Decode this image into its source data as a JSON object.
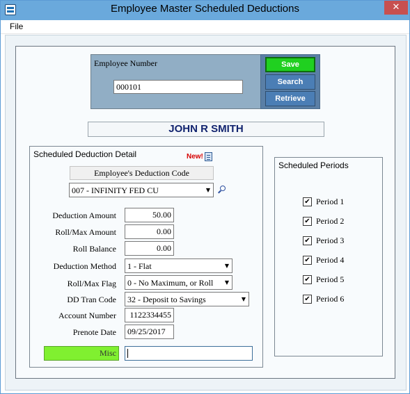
{
  "window": {
    "title": "Employee Master Scheduled Deductions",
    "close_glyph": "✕"
  },
  "menu": {
    "file": "File"
  },
  "employee": {
    "label": "Employee Number",
    "number": "000101",
    "name": "JOHN R SMITH"
  },
  "buttons": {
    "save": "Save",
    "search": "Search",
    "retrieve": "Retrieve"
  },
  "detail": {
    "title": "Scheduled Deduction Detail",
    "new_badge": "New!",
    "code_header": "Employee's Deduction Code",
    "code_value": "007 - INFINITY FED CU",
    "fields": {
      "deduction_amount_label": "Deduction Amount",
      "deduction_amount": "50.00",
      "roll_max_amount_label": "Roll/Max Amount",
      "roll_max_amount": "0.00",
      "roll_balance_label": "Roll Balance",
      "roll_balance": "0.00",
      "deduction_method_label": "Deduction Method",
      "deduction_method": "1 - Flat",
      "roll_max_flag_label": "Roll/Max Flag",
      "roll_max_flag": "0 - No Maximum, or Roll",
      "dd_tran_code_label": "DD Tran Code",
      "dd_tran_code": "32 - Deposit to Savings",
      "account_number_label": "Account Number",
      "account_number": "1122334455",
      "prenote_date_label": "Prenote Date",
      "prenote_date": "09/25/2017",
      "misc_label": "Misc",
      "misc_value": ""
    }
  },
  "periods": {
    "title": "Scheduled Periods",
    "items": [
      {
        "label": "Period 1",
        "checked": true
      },
      {
        "label": "Period 2",
        "checked": true
      },
      {
        "label": "Period 3",
        "checked": true
      },
      {
        "label": "Period 4",
        "checked": true
      },
      {
        "label": "Period 5",
        "checked": true
      },
      {
        "label": "Period 6",
        "checked": true
      }
    ],
    "check_glyph": "✔"
  },
  "icons": {
    "app": "app-icon",
    "magnify": "magnifier-icon",
    "doc": "document-icon",
    "dropdown": "chevron-down-icon"
  },
  "colors": {
    "titlebar": "#6aa9dc",
    "save_button": "#20d020",
    "nav_buttons": "#4b7eb5",
    "employee_panel": "#91aec5",
    "name_text": "#12246f",
    "misc_label_bg": "#80f030"
  }
}
